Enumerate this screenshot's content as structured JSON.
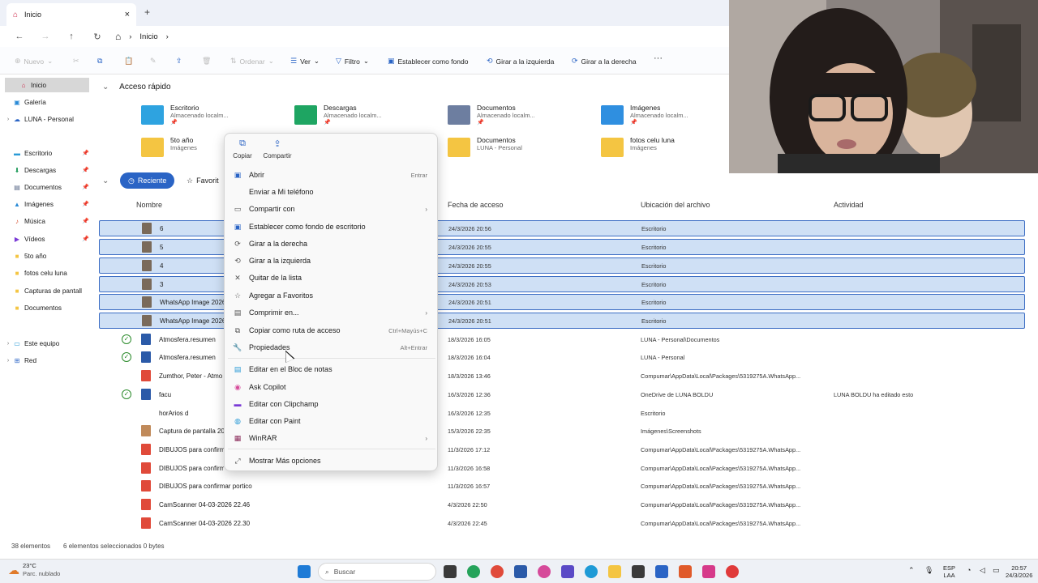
{
  "window": {
    "tab_title": "Inicio",
    "close_icon": "×",
    "new_tab_icon": "+",
    "controls": {
      "minimize": "—",
      "maximize": "☐",
      "close": "✕"
    }
  },
  "nav": {
    "back": "←",
    "forward": "→",
    "up": "↑",
    "refresh": "↻",
    "home_icon": "⌂",
    "breadcrumb_sep": "›",
    "breadcrumb": "Inicio",
    "breadcrumb_trailing": "›"
  },
  "toolbar": {
    "nuevo": "Nuevo",
    "ordenar": "Ordenar",
    "ver": "Ver",
    "filtro": "Filtro",
    "establecer_fondo": "Establecer como fondo",
    "girar_izquierda": "Girar a la izquierda",
    "girar_derecha": "Girar a la derecha",
    "more": "···"
  },
  "sidebar": {
    "items": [
      {
        "label": "Inicio"
      },
      {
        "label": "Galería"
      },
      {
        "label": "LUNA - Personal"
      },
      {
        "label": "Escritorio"
      },
      {
        "label": "Descargas"
      },
      {
        "label": "Documentos"
      },
      {
        "label": "Imágenes"
      },
      {
        "label": "Música"
      },
      {
        "label": "Vídeos"
      },
      {
        "label": "5to año"
      },
      {
        "label": "fotos celu luna"
      },
      {
        "label": "Capturas de pantall"
      },
      {
        "label": "Documentos"
      },
      {
        "label": "Este equipo"
      },
      {
        "label": "Red"
      }
    ]
  },
  "quick_access": {
    "title": "Acceso rápido",
    "items": [
      {
        "name": "Escritorio",
        "sub": "Almacenado localm..."
      },
      {
        "name": "Descargas",
        "sub": "Almacenado localm..."
      },
      {
        "name": "Documentos",
        "sub": "Almacenado localm..."
      },
      {
        "name": "Imágenes",
        "sub": "Almacenado localm..."
      },
      {
        "name": "5to año",
        "sub": "Imágenes"
      },
      {
        "name": "Documentos",
        "sub": "LUNA - Personal"
      },
      {
        "name": "fotos celu luna",
        "sub": "Imágenes"
      }
    ]
  },
  "recent": {
    "tab_reciente": "Reciente",
    "tab_favoritos": "Favorit",
    "col_nombre": "Nombre",
    "col_fecha": "Fecha de acceso",
    "col_ubicacion": "Ubicación del archivo",
    "col_actividad": "Actividad",
    "rows": [
      {
        "name": "6",
        "date": "24/3/2026 20:56",
        "loc": "Escritorio",
        "act": ""
      },
      {
        "name": "5",
        "date": "24/3/2026 20:55",
        "loc": "Escritorio",
        "act": ""
      },
      {
        "name": "4",
        "date": "24/3/2026 20:55",
        "loc": "Escritorio",
        "act": ""
      },
      {
        "name": "3",
        "date": "24/3/2026 20:53",
        "loc": "Escritorio",
        "act": ""
      },
      {
        "name": "WhatsApp Image 2026",
        "date": "24/3/2026 20:51",
        "loc": "Escritorio",
        "act": ""
      },
      {
        "name": "WhatsApp Image 2026",
        "date": "24/3/2026 20:51",
        "loc": "Escritorio",
        "act": ""
      },
      {
        "name": "Atmosfera.resumen",
        "date": "18/3/2026 16:05",
        "loc": "LUNA - Personal\\Documentos",
        "act": ""
      },
      {
        "name": "Atmosfera.resumen",
        "date": "18/3/2026 16:04",
        "loc": "LUNA - Personal",
        "act": ""
      },
      {
        "name": "Zumthor, Peter - Atmo",
        "date": "18/3/2026 13:46",
        "loc": "Compumar\\AppData\\Local\\Packages\\5319275A.WhatsApp...",
        "act": ""
      },
      {
        "name": "facu",
        "date": "16/3/2026 12:36",
        "loc": "OneDrive de LUNA BOLDU",
        "act": "LUNA BOLDU ha editado esto"
      },
      {
        "name": "horArios d",
        "date": "16/3/2026 12:35",
        "loc": "Escritorio",
        "act": ""
      },
      {
        "name": "Captura de pantalla 20",
        "date": "15/3/2026 22:35",
        "loc": "Imágenes\\Screenshots",
        "act": ""
      },
      {
        "name": "DIBUJOS para confirm",
        "date": "11/3/2026 17:12",
        "loc": "Compumar\\AppData\\Local\\Packages\\5319275A.WhatsApp...",
        "act": ""
      },
      {
        "name": "DIBUJOS para confirm",
        "date": "11/3/2026 16:58",
        "loc": "Compumar\\AppData\\Local\\Packages\\5319275A.WhatsApp...",
        "act": ""
      },
      {
        "name": "DIBUJOS para confirmar portico",
        "date": "11/3/2026 16:57",
        "loc": "Compumar\\AppData\\Local\\Packages\\5319275A.WhatsApp...",
        "act": ""
      },
      {
        "name": "CamScanner 04-03-2026 22.46",
        "date": "4/3/2026 22:50",
        "loc": "Compumar\\AppData\\Local\\Packages\\5319275A.WhatsApp...",
        "act": ""
      },
      {
        "name": "CamScanner 04-03-2026 22.30",
        "date": "4/3/2026 22:45",
        "loc": "Compumar\\AppData\\Local\\Packages\\5319275A.WhatsApp...",
        "act": ""
      }
    ]
  },
  "status": {
    "count": "38 elementos",
    "selected": "6 elementos seleccionados  0 bytes"
  },
  "context_menu": {
    "copiar": "Copiar",
    "compartir": "Compartir",
    "items": [
      {
        "label": "Abrir",
        "shortcut": "Entrar",
        "arrow": ""
      },
      {
        "label": "Enviar a Mi teléfono",
        "shortcut": "",
        "arrow": ""
      },
      {
        "label": "Compartir con",
        "shortcut": "",
        "arrow": "›"
      },
      {
        "label": "Establecer como fondo de escritorio",
        "shortcut": "",
        "arrow": ""
      },
      {
        "label": "Girar a la derecha",
        "shortcut": "",
        "arrow": ""
      },
      {
        "label": "Girar a la izquierda",
        "shortcut": "",
        "arrow": ""
      },
      {
        "label": "Quitar de la lista",
        "shortcut": "",
        "arrow": ""
      },
      {
        "label": "Agregar a Favoritos",
        "shortcut": "",
        "arrow": ""
      },
      {
        "label": "Comprimir en...",
        "shortcut": "",
        "arrow": "›"
      },
      {
        "label": "Copiar como ruta de acceso",
        "shortcut": "Ctrl+Mayús+C",
        "arrow": ""
      },
      {
        "label": "Propiedades",
        "shortcut": "Alt+Entrar",
        "arrow": ""
      },
      {
        "label": "Editar en el Bloc de notas",
        "shortcut": "",
        "arrow": ""
      },
      {
        "label": "Ask Copilot",
        "shortcut": "",
        "arrow": ""
      },
      {
        "label": "Editar con Clipchamp",
        "shortcut": "",
        "arrow": ""
      },
      {
        "label": "Editar con Paint",
        "shortcut": "",
        "arrow": ""
      },
      {
        "label": "WinRAR",
        "shortcut": "",
        "arrow": "›"
      },
      {
        "label": "Mostrar Más opciones",
        "shortcut": "",
        "arrow": ""
      }
    ]
  },
  "taskbar": {
    "weather_temp": "23°C",
    "weather_desc": "Parc. nublado",
    "search_placeholder": "Buscar",
    "lang": "ESP",
    "lang2": "LAA",
    "time": "20:57",
    "date": "24/3/2026"
  },
  "colors": {
    "accent": "#2a64c5",
    "selection": "#cfe0f5",
    "selection_border": "#3c6dc4",
    "folder_yellow": "#f4c542"
  }
}
